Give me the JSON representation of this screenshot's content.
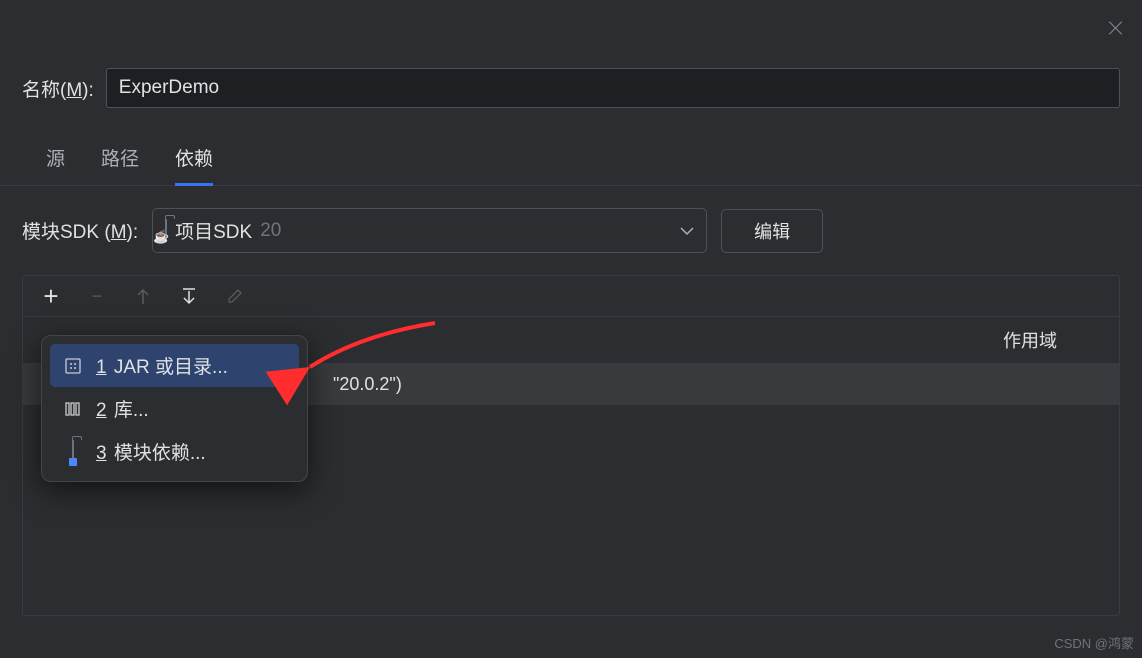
{
  "top": {
    "close": "×"
  },
  "name": {
    "label_pre": "名称(",
    "label_m": "M",
    "label_post": "):",
    "value": "ExperDemo"
  },
  "tabs": [
    {
      "label": "源",
      "active": false
    },
    {
      "label": "路径",
      "active": false
    },
    {
      "label": "依赖",
      "active": true
    }
  ],
  "sdk": {
    "label_pre": "模块SDK (",
    "label_m": "M",
    "label_post": "):",
    "selected": "项目SDK",
    "version": "20",
    "edit": "编辑"
  },
  "toolbar": {
    "plus": "+",
    "minus": "−",
    "up": "↑",
    "down": "↓",
    "pencil": "✎"
  },
  "table": {
    "scope_header": "作用域",
    "row_text": "\"20.0.2\")"
  },
  "menu": {
    "items": [
      {
        "num": "1",
        "label": "JAR 或目录..."
      },
      {
        "num": "2",
        "label": "库..."
      },
      {
        "num": "3",
        "label": "模块依赖..."
      }
    ]
  },
  "watermark": "CSDN @鸿蒙"
}
